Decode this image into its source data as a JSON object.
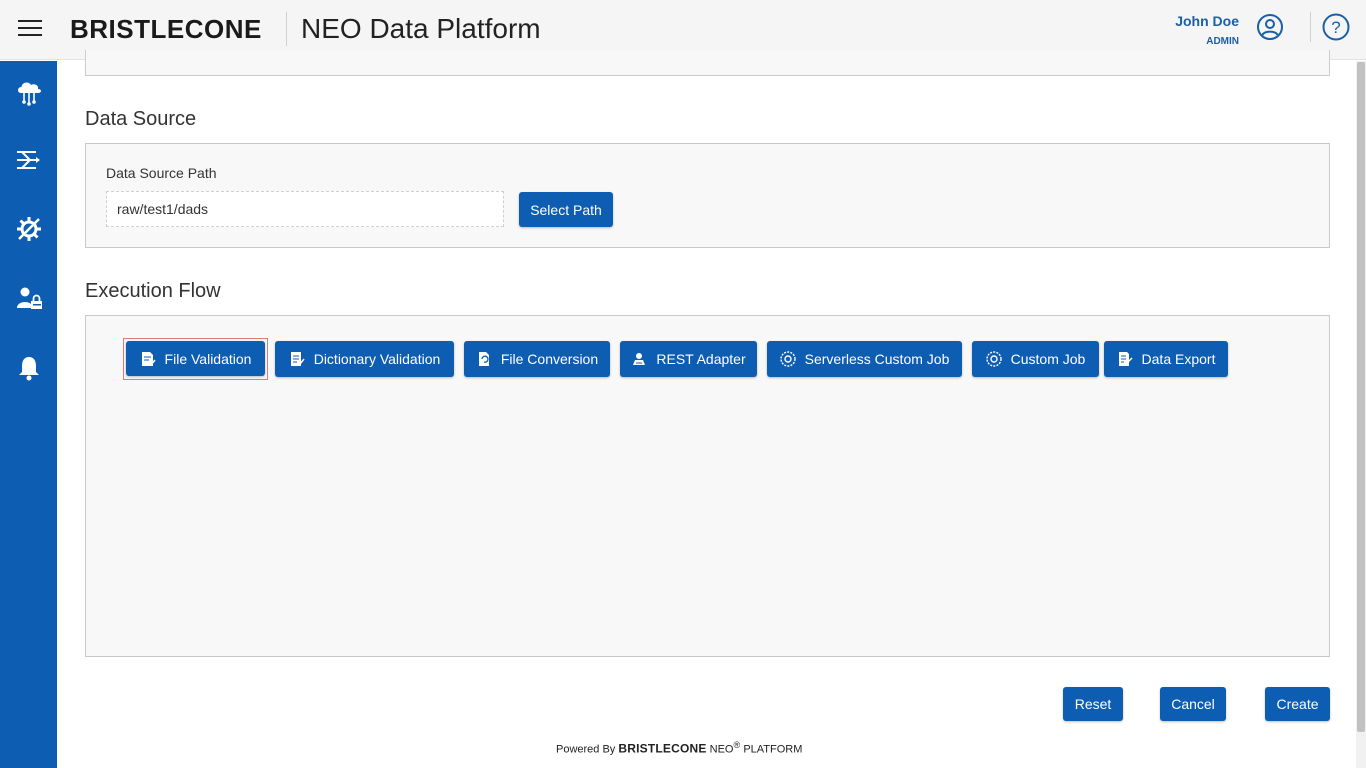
{
  "header": {
    "brand": "BRISTLECONE",
    "app_title": "NEO Data Platform",
    "user_name": "John Doe",
    "user_role": "ADMIN"
  },
  "sidebar": {
    "items": [
      {
        "icon": "cloud-network-icon"
      },
      {
        "icon": "data-flow-icon"
      },
      {
        "icon": "settings-tools-icon"
      },
      {
        "icon": "user-lock-icon"
      },
      {
        "icon": "bell-icon"
      }
    ]
  },
  "data_source": {
    "title": "Data Source",
    "path_label": "Data Source Path",
    "path_value": "raw/test1/dads",
    "select_path_label": "Select Path"
  },
  "execution_flow": {
    "title": "Execution Flow",
    "steps": [
      {
        "label": "File Validation",
        "icon": "file-check-icon",
        "selected": true
      },
      {
        "label": "Dictionary Validation",
        "icon": "dictionary-icon"
      },
      {
        "label": "File Conversion",
        "icon": "file-convert-icon"
      },
      {
        "label": "REST Adapter",
        "icon": "rest-adapter-icon"
      },
      {
        "label": "Serverless Custom Job",
        "icon": "gear-badge-icon"
      },
      {
        "label": "Custom Job",
        "icon": "gear-badge-icon"
      },
      {
        "label": "Data Export",
        "icon": "export-icon"
      }
    ]
  },
  "actions": {
    "reset": "Reset",
    "cancel": "Cancel",
    "create": "Create"
  },
  "footer": {
    "powered_by": "Powered By",
    "brand": "BRISTLECONE",
    "product": "NEO",
    "registered": "®",
    "platform": "PLATFORM"
  },
  "colors": {
    "primary": "#0d5db3",
    "selected_outline": "#e07a7a"
  }
}
